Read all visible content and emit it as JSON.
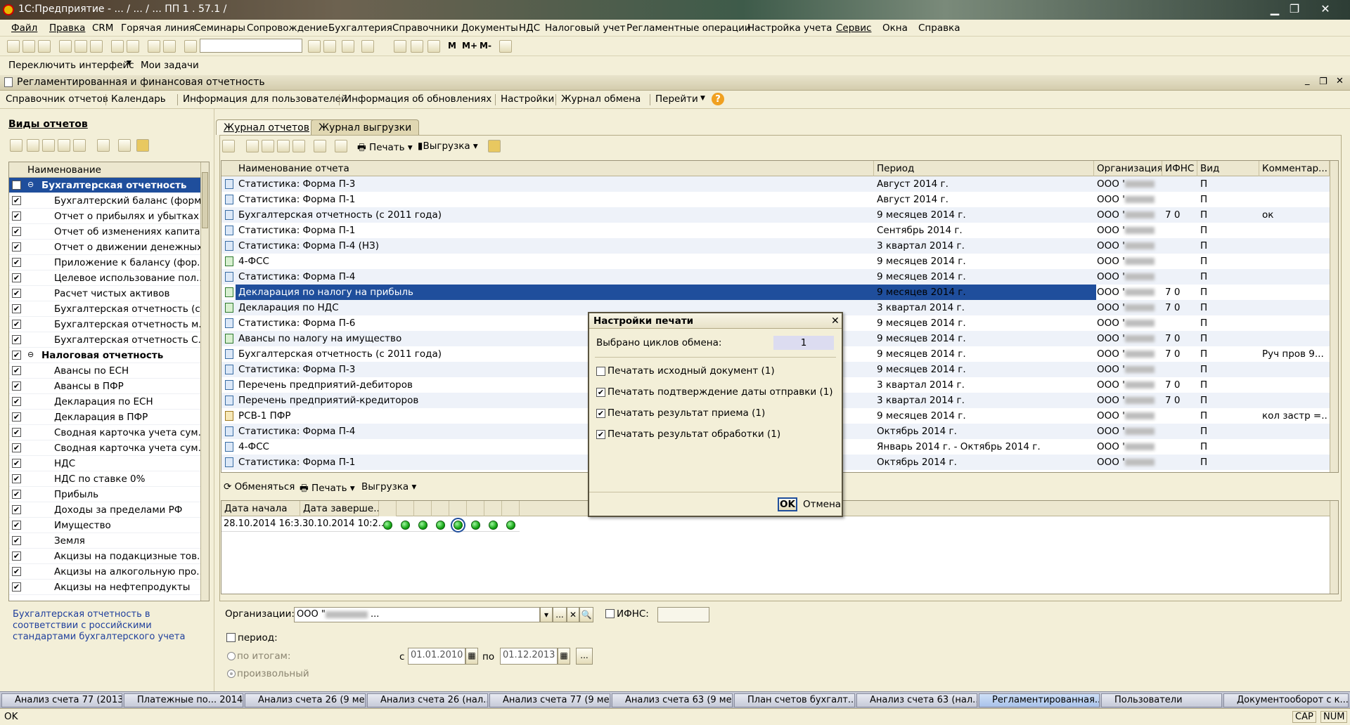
{
  "window": {
    "title": "1С:Предприятие - ... / ... / ... ПП 1 . 57.1 /"
  },
  "menu": [
    "Файл",
    "Правка",
    "CRM",
    "Горячая линия",
    "Семинары",
    "Сопровождение",
    "Бухгалтерия",
    "Справочники",
    "Документы",
    "НДС",
    "Налоговый учет",
    "Регламентные операции",
    "Настройка учета",
    "Сервис",
    "Окна",
    "Справка"
  ],
  "row2": {
    "switch": "Переключить интерфейс",
    "tasks": "Мои задачи"
  },
  "subwindow": {
    "title": "Регламентированная и финансовая отчетность"
  },
  "cmdbar": [
    "Справочник отчетов",
    "Календарь",
    "Информация для пользователей",
    "Информация об обновлениях",
    "Настройки",
    "Журнал обмена",
    "Перейти"
  ],
  "left": {
    "heading": "Виды отчетов",
    "col": "Наименование",
    "items": [
      {
        "label": "Бухгалтерская отчетность",
        "group": true
      },
      {
        "label": "Бухгалтерский баланс (форм..."
      },
      {
        "label": "Отчет о прибылях и убытках (..."
      },
      {
        "label": "Отчет об изменениях капита..."
      },
      {
        "label": "Отчет о движении денежных ..."
      },
      {
        "label": "Приложение к балансу (фор..."
      },
      {
        "label": "Целевое использование пол..."
      },
      {
        "label": "Расчет чистых активов"
      },
      {
        "label": "Бухгалтерская отчетность (с..."
      },
      {
        "label": "Бухгалтерская отчетность м..."
      },
      {
        "label": "Бухгалтерская отчетность С..."
      },
      {
        "label": "Налоговая отчетность",
        "group": true
      },
      {
        "label": "Авансы по ЕСН"
      },
      {
        "label": "Авансы в ПФР"
      },
      {
        "label": "Декларация по ЕСН"
      },
      {
        "label": "Декларация в ПФР"
      },
      {
        "label": "Сводная карточка учета сум..."
      },
      {
        "label": "Сводная карточка учета сум..."
      },
      {
        "label": "НДС"
      },
      {
        "label": "НДС по ставке 0%"
      },
      {
        "label": "Прибыль"
      },
      {
        "label": "Доходы за пределами РФ"
      },
      {
        "label": "Имущество"
      },
      {
        "label": "Земля"
      },
      {
        "label": "Акцизы на подакцизные тов..."
      },
      {
        "label": "Акцизы на алкогольную про..."
      },
      {
        "label": "Акцизы на нефтепродукты"
      }
    ],
    "description": "Бухгалтерская отчетность в соответствии с российскими стандартами бухгалтерского учета"
  },
  "tabs": [
    "Журнал отчетов",
    "Журнал выгрузки"
  ],
  "journal_toolbar": {
    "print": "Печать",
    "export": "Выгрузка"
  },
  "grid": {
    "columns": [
      "Наименование отчета",
      "Период",
      "Организация",
      "ИФНС",
      "Вид",
      "Комментар..."
    ],
    "rows": [
      {
        "name": "Статистика: Форма П-3",
        "period": "Август 2014 г.",
        "org": "ООО \"",
        "ifns": "",
        "kind": "П",
        "comment": "",
        "icon": "b"
      },
      {
        "name": "Статистика: Форма П-1",
        "period": "Август 2014 г.",
        "org": "ООО \"",
        "ifns": "",
        "kind": "П",
        "comment": "",
        "icon": "b"
      },
      {
        "name": "Бухгалтерская отчетность (с 2011 года)",
        "period": "9 месяцев 2014 г.",
        "org": "ООО \"",
        "ifns": "7  0",
        "kind": "П",
        "comment": "ок",
        "icon": "b"
      },
      {
        "name": "Статистика: Форма П-1",
        "period": "Сентябрь 2014 г.",
        "org": "ООО \"",
        "ifns": "",
        "kind": "П",
        "comment": "",
        "icon": "b"
      },
      {
        "name": "Статистика: Форма П-4 (НЗ)",
        "period": "3 квартал 2014 г.",
        "org": "ООО \"",
        "ifns": "",
        "kind": "П",
        "comment": "",
        "icon": "b"
      },
      {
        "name": "4-ФСС",
        "period": "9 месяцев 2014 г.",
        "org": "ООО \"",
        "ifns": "",
        "kind": "П",
        "comment": "",
        "icon": "g"
      },
      {
        "name": "Статистика: Форма П-4",
        "period": "9 месяцев 2014 г.",
        "org": "ООО \"",
        "ifns": "",
        "kind": "П",
        "comment": "",
        "icon": "b"
      },
      {
        "name": "Декларация по налогу на прибыль",
        "period": "9 месяцев 2014 г.",
        "org": "ООО \"",
        "ifns": "7  0",
        "kind": "П",
        "comment": "",
        "icon": "g",
        "selected": true
      },
      {
        "name": "Декларация по НДС",
        "period": "3 квартал 2014 г.",
        "org": "ООО \"",
        "ifns": "7  0",
        "kind": "П",
        "comment": "",
        "icon": "g"
      },
      {
        "name": "Статистика: Форма П-6",
        "period": "9 месяцев 2014 г.",
        "org": "ООО \"",
        "ifns": "",
        "kind": "П",
        "comment": "",
        "icon": "b"
      },
      {
        "name": "Авансы по налогу на имущество",
        "period": "9 месяцев 2014 г.",
        "org": "ООО \"",
        "ifns": "7  0",
        "kind": "П",
        "comment": "",
        "icon": "g"
      },
      {
        "name": "Бухгалтерская отчетность (с 2011 года)",
        "period": "9 месяцев 2014 г.",
        "org": "ООО \"",
        "ifns": "7  0",
        "kind": "П",
        "comment": "Руч пров 9...",
        "icon": "b"
      },
      {
        "name": "Статистика: Форма П-3",
        "period": "9 месяцев 2014 г.",
        "org": "ООО \"",
        "ifns": "",
        "kind": "П",
        "comment": "",
        "icon": "b"
      },
      {
        "name": "Перечень предприятий-дебиторов",
        "period": "3 квартал 2014 г.",
        "org": "ООО \"",
        "ifns": "7  0",
        "kind": "П",
        "comment": "",
        "icon": "b"
      },
      {
        "name": "Перечень предприятий-кредиторов",
        "period": "3 квартал 2014 г.",
        "org": "ООО \"",
        "ifns": "7  0",
        "kind": "П",
        "comment": "",
        "icon": "b"
      },
      {
        "name": "РСВ-1 ПФР",
        "period": "9 месяцев 2014 г.",
        "org": "ООО \"",
        "ifns": "",
        "kind": "П",
        "comment": "кол застр =...",
        "icon": "o"
      },
      {
        "name": "Статистика: Форма П-4",
        "period": "Октябрь 2014 г.",
        "org": "ООО \"",
        "ifns": "",
        "kind": "П",
        "comment": "",
        "icon": "b"
      },
      {
        "name": "4-ФСС",
        "period": "Январь 2014 г. - Октябрь 2014 г.",
        "org": "ООО \"",
        "ifns": "",
        "kind": "П",
        "comment": "",
        "icon": "b"
      },
      {
        "name": "Статистика: Форма П-1",
        "period": "Октябрь 2014 г.",
        "org": "ООО \"",
        "ifns": "",
        "kind": "П",
        "comment": "",
        "icon": "b"
      }
    ]
  },
  "exchange": {
    "toolbar": {
      "exchange": "Обменяться",
      "print": "Печать",
      "export": "Выгрузка"
    },
    "columns": [
      "Дата начала",
      "Дата заверше..."
    ],
    "row": {
      "start": "28.10.2014 16:3...",
      "end": "30.10.2014 10:2..."
    }
  },
  "dialog": {
    "title": "Настройки печати",
    "cycles_label": "Выбрано циклов обмена:",
    "cycles_value": "1",
    "options": [
      {
        "label": "Печатать исходный документ (1)",
        "checked": false
      },
      {
        "label": "Печатать подтверждение даты отправки (1)",
        "checked": true
      },
      {
        "label": "Печатать результат приема (1)",
        "checked": true
      },
      {
        "label": "Печатать результат обработки (1)",
        "checked": true
      }
    ],
    "ok": "OK",
    "cancel": "Отмена"
  },
  "filters": {
    "org_label": "Организации:",
    "org_value": "ООО \"",
    "ifns_label": "ИФНС:",
    "period_label": "период:",
    "by_totals": "по итогам:",
    "arbitrary": "произвольный",
    "from_label": "с",
    "from_value": "01.01.2010",
    "to_label": "по",
    "to_value": "01.12.2013"
  },
  "taskbar": [
    "Анализ счета 77 (2013...",
    "Платежные по... 2014 г.",
    "Анализ счета 26 (9 ме...",
    "Анализ счета 26 (нал...",
    "Анализ счета 77 (9 ме...",
    "Анализ счета 63 (9 ме...",
    "План счетов бухгалт...",
    "Анализ счета 63 (нал...",
    "Регламентированная...",
    "Пользователи",
    "Документооборот с к..."
  ],
  "status": {
    "left": "OK",
    "cap": "CAP",
    "num": "NUM"
  }
}
